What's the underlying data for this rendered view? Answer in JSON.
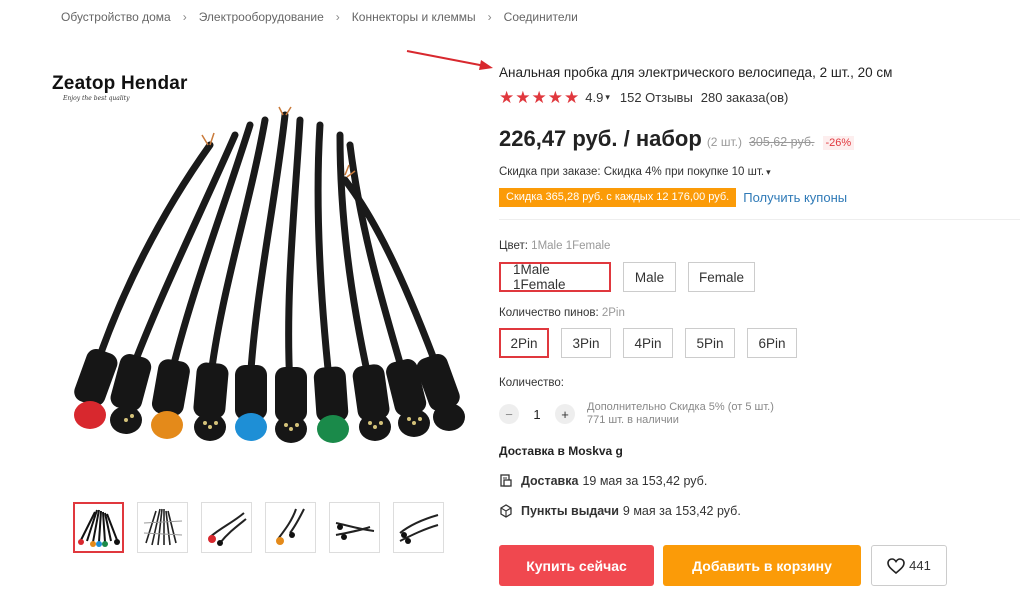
{
  "breadcrumb": [
    "Обустройство дома",
    "Электрооборудование",
    "Коннекторы и клеммы",
    "Соединители"
  ],
  "brand": {
    "name": "Zeatop Hendar",
    "tagline": "Enjoy the best quality"
  },
  "product": {
    "title": "Анальная пробка для электрического велосипеда, 2 шт., 20 см",
    "rating": "4.9",
    "stars": 5,
    "reviews": "152 Отзывы",
    "orders": "280 заказа(ов)",
    "price": "226,47 руб. / набор",
    "unit_count": "(2 шт.)",
    "old_price": "305,62 руб.",
    "discount": "-26%",
    "order_discount": "Скидка при заказе: Скидка 4% при покупке 10 шт.",
    "coupon_badge": "Скидка 365,28 руб. с каждых 12 176,00 руб.",
    "get_coupons": "Получить купоны"
  },
  "color": {
    "label": "Цвет:",
    "selected": "1Male 1Female",
    "options": [
      "1Male 1Female",
      "Male",
      "Female"
    ]
  },
  "pins": {
    "label": "Количество пинов:",
    "selected": "2Pin",
    "options": [
      "2Pin",
      "3Pin",
      "4Pin",
      "5Pin",
      "6Pin"
    ]
  },
  "quantity": {
    "label": "Количество:",
    "value": "1",
    "minus": "−",
    "plus": "+",
    "note_line1": "Дополнительно Скидка 5% (от 5 шт.)",
    "note_line2": "771 шт. в наличии"
  },
  "delivery": {
    "heading": "Доставка в Moskva g",
    "courier_label": "Доставка",
    "courier_text": "19 мая за 153,42 руб.",
    "pickup_label": "Пункты выдачи",
    "pickup_text": "9 мая за 153,42 руб."
  },
  "actions": {
    "buy": "Купить сейчас",
    "cart": "Добавить в корзину",
    "wishlist_count": "441"
  },
  "colors": {
    "accent": "#e0383e",
    "buy": "#f0484f",
    "cart": "#fb9b08",
    "link": "#2f7ab7"
  },
  "connector_colors": [
    "#d8282e",
    "#e48a1a",
    "#1e8fd6",
    "#1a8a4a",
    "#111111"
  ],
  "icons": [
    "chevron-right-icon",
    "star-icon",
    "chevron-down-icon",
    "truck-icon",
    "pickup-box-icon",
    "heart-icon",
    "red-arrow"
  ]
}
